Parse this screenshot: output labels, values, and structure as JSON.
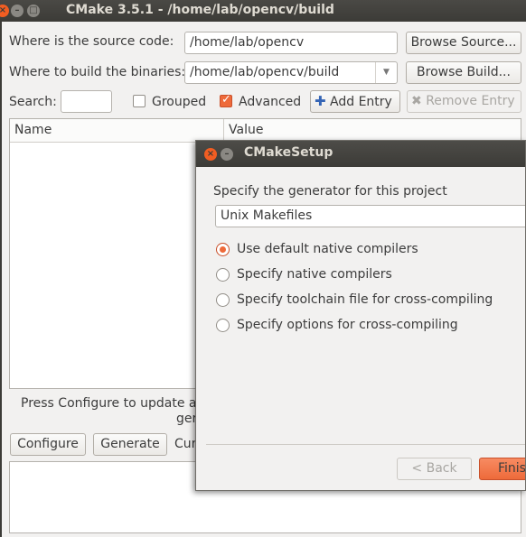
{
  "window": {
    "title": "CMake 3.5.1 - /home/lab/opencv/build"
  },
  "source": {
    "label": "Where is the source code:",
    "value": "/home/lab/opencv",
    "browse_label": "Browse Source..."
  },
  "build": {
    "label": "Where to build the binaries:",
    "value": "/home/lab/opencv/build",
    "browse_label": "Browse Build..."
  },
  "search": {
    "label": "Search:",
    "value": ""
  },
  "grouped": {
    "label": "Grouped",
    "checked": false
  },
  "advanced": {
    "label": "Advanced",
    "checked": true
  },
  "add_entry_label": "Add Entry",
  "remove_entry_label": "Remove Entry",
  "table": {
    "columns": [
      "Name",
      "Value"
    ]
  },
  "status_line1": "Press Configure to update ar",
  "status_line2": "ger",
  "configure_label": "Configure",
  "generate_label": "Generate",
  "current_partial": "Cur",
  "dialog": {
    "title": "CMakeSetup",
    "prompt": "Specify the generator for this project",
    "generator": "Unix Makefiles",
    "options": [
      "Use default native compilers",
      "Specify native compilers",
      "Specify toolchain file for cross-compiling",
      "Specify options for cross-compiling"
    ],
    "selected_option": 0,
    "back_label": "< Back",
    "finish_label": "Finis"
  },
  "colors": {
    "accent": "#ee6a3a",
    "titlebar": "#3c3b37",
    "window_bg": "#f2f1f0"
  }
}
